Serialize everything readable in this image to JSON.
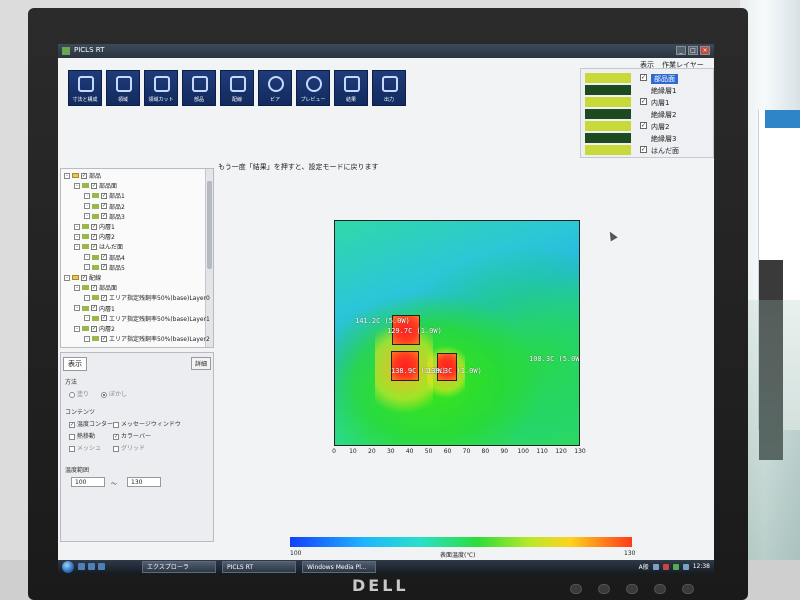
{
  "monitor": {
    "brand": "DELL"
  },
  "window": {
    "title": "PICLS RT",
    "controls": [
      "_",
      "□",
      "×"
    ]
  },
  "toolbar": {
    "buttons": [
      {
        "label": "寸法と構成",
        "icon": "dimensions-icon"
      },
      {
        "label": "領域",
        "icon": "area-icon"
      },
      {
        "label": "領域カット",
        "icon": "cut-icon"
      },
      {
        "label": "部品",
        "icon": "component-icon"
      },
      {
        "label": "配線",
        "icon": "wiring-icon"
      },
      {
        "label": "ビア",
        "icon": "via-icon"
      },
      {
        "label": "プレビュー",
        "icon": "preview-icon"
      },
      {
        "label": "結果",
        "icon": "result-icon"
      },
      {
        "label": "出力",
        "icon": "print-icon"
      }
    ]
  },
  "menu": {
    "items": [
      "表示",
      "作業レイヤー"
    ]
  },
  "layers": {
    "colors": {
      "copper": "#c9d93a",
      "insulator": "#1e4a22"
    },
    "rows": [
      {
        "name": "部品面",
        "checked": true,
        "selected": true,
        "swatch": "copper"
      },
      {
        "name": "絶縁層1",
        "checked": false,
        "selected": false,
        "swatch": "insulator"
      },
      {
        "name": "内層1",
        "checked": true,
        "selected": false,
        "swatch": "copper"
      },
      {
        "name": "絶縁層2",
        "checked": false,
        "selected": false,
        "swatch": "insulator"
      },
      {
        "name": "内層2",
        "checked": true,
        "selected": false,
        "swatch": "copper"
      },
      {
        "name": "絶縁層3",
        "checked": false,
        "selected": false,
        "swatch": "insulator"
      },
      {
        "name": "はんだ面",
        "checked": true,
        "selected": false,
        "swatch": "copper"
      }
    ]
  },
  "tree": {
    "items": [
      {
        "text": "部品",
        "level": 0,
        "folder": true
      },
      {
        "text": "部品面",
        "level": 1,
        "folder": false
      },
      {
        "text": "部品1",
        "level": 2,
        "folder": false
      },
      {
        "text": "部品2",
        "level": 2,
        "folder": false
      },
      {
        "text": "部品3",
        "level": 2,
        "folder": false
      },
      {
        "text": "内層1",
        "level": 1,
        "folder": false
      },
      {
        "text": "内層2",
        "level": 1,
        "folder": false
      },
      {
        "text": "はんだ面",
        "level": 1,
        "folder": false
      },
      {
        "text": "部品4",
        "level": 2,
        "folder": false
      },
      {
        "text": "部品5",
        "level": 2,
        "folder": false
      },
      {
        "text": "配線",
        "level": 0,
        "folder": true
      },
      {
        "text": "部品面",
        "level": 1,
        "folder": false
      },
      {
        "text": "エリア指定残銅率50%(base)Layer0",
        "level": 2,
        "folder": false
      },
      {
        "text": "内層1",
        "level": 1,
        "folder": false
      },
      {
        "text": "エリア指定残銅率50%(base)Layer1",
        "level": 2,
        "folder": false
      },
      {
        "text": "内層2",
        "level": 1,
        "folder": false
      },
      {
        "text": "エリア指定残銅率50%(base)Layer2",
        "level": 2,
        "folder": false
      }
    ]
  },
  "props": {
    "tab": "表示",
    "detail_button": "詳細",
    "method_label": "方法",
    "method_options": [
      "塗り",
      "ぼかし"
    ],
    "contents_label": "コンテンツ",
    "contents": [
      {
        "label": "温度コンター",
        "checked": true,
        "enabled": true
      },
      {
        "label": "メッセージウィンドウ",
        "checked": false,
        "enabled": true
      },
      {
        "label": "熱移動",
        "checked": false,
        "enabled": true
      },
      {
        "label": "カラーバー",
        "checked": true,
        "enabled": true
      },
      {
        "label": "メッシュ",
        "checked": false,
        "enabled": false
      },
      {
        "label": "グリッド",
        "checked": false,
        "enabled": false
      }
    ],
    "temp_range_label": "温度範囲",
    "temp_min": "100",
    "temp_max": "130",
    "range_sep": "〜"
  },
  "hint": "もう一度「結果」を押すと、設定モードに戻ります",
  "plot": {
    "x_ticks": [
      "0",
      "10",
      "20",
      "30",
      "40",
      "50",
      "60",
      "70",
      "80",
      "90",
      "100",
      "110",
      "120",
      "130"
    ],
    "labels": [
      {
        "text": "141.2C (5.0W)"
      },
      {
        "text": "129.7C (1.0W)"
      },
      {
        "text": "138.9C (1.0W)"
      },
      {
        "text": "138.3C (1.0W)"
      },
      {
        "text": "108.3C (5.0W)"
      }
    ]
  },
  "colorbar": {
    "min": "100",
    "max": "130",
    "title": "表面温度(℃)"
  },
  "taskbar": {
    "explorer": "エクスプローラ",
    "app": "PICLS RT",
    "media": "Windows Media Pl...",
    "ime": "A般",
    "clock": "12:38"
  }
}
